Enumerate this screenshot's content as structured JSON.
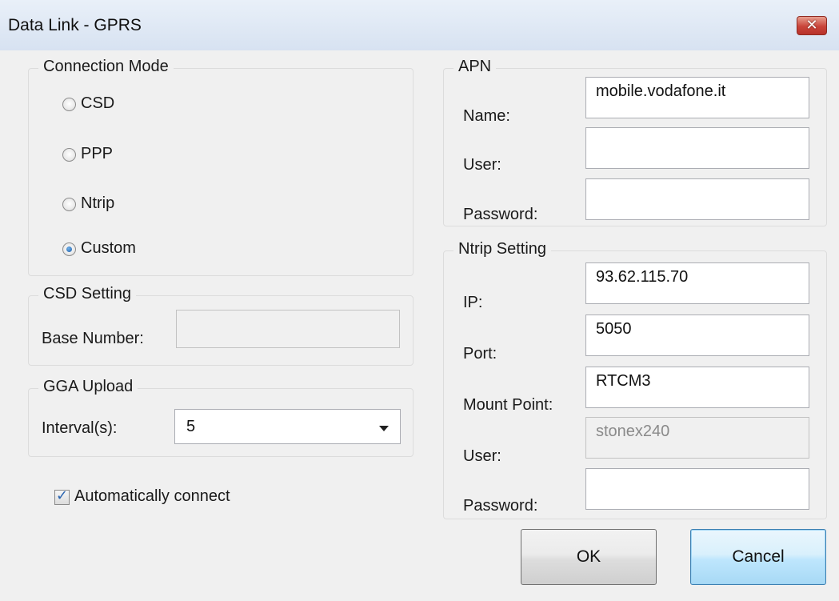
{
  "window": {
    "title": "Data Link - GPRS",
    "close_symbol": "✕"
  },
  "connection_mode": {
    "title": "Connection Mode",
    "options": [
      {
        "label": "CSD",
        "checked": false
      },
      {
        "label": "PPP",
        "checked": false
      },
      {
        "label": "Ntrip",
        "checked": false
      },
      {
        "label": "Custom",
        "checked": true
      }
    ]
  },
  "csd_setting": {
    "title": "CSD Setting",
    "base_number_label": "Base Number:",
    "base_number_value": ""
  },
  "gga_upload": {
    "title": "GGA Upload",
    "interval_label": "Interval(s):",
    "interval_value": "5"
  },
  "auto_connect": {
    "label": "Automatically connect",
    "checked": true,
    "mark": "✓"
  },
  "apn": {
    "title": "APN",
    "name_label": "Name:",
    "name_value": "mobile.vodafone.it",
    "user_label": "User:",
    "user_value": "",
    "password_label": "Password:",
    "password_value": ""
  },
  "ntrip_setting": {
    "title": "Ntrip Setting",
    "ip_label": "IP:",
    "ip_value": "93.62.115.70",
    "port_label": "Port:",
    "port_value": "5050",
    "mount_label": "Mount Point:",
    "mount_value": "RTCM3",
    "user_label": "User:",
    "user_value": "stonex240",
    "password_label": "Password:",
    "password_value": ""
  },
  "buttons": {
    "ok": "OK",
    "cancel": "Cancel"
  },
  "colors": {
    "titlebar": "#dbe6f4",
    "close": "#c9443a",
    "dialog_bg": "#f0f0f0",
    "default_button": "#bee6fd"
  }
}
